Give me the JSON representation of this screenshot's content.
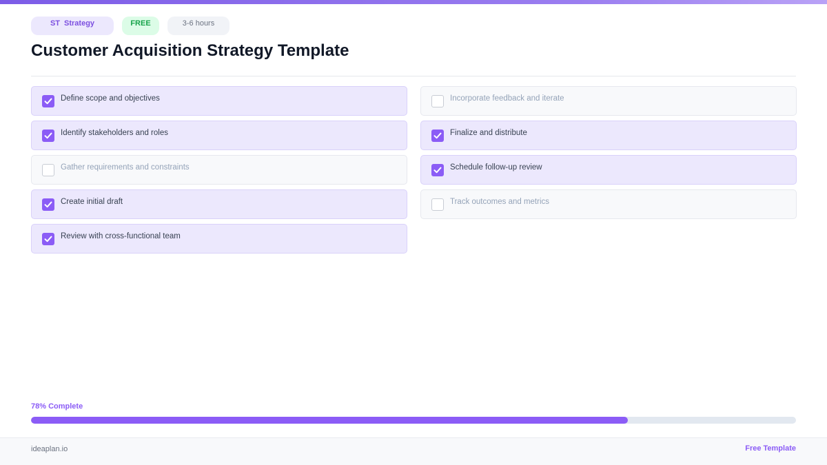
{
  "header": {
    "category_code": "ST",
    "category": "Strategy",
    "price": "FREE",
    "duration": "3-6 hours",
    "title": "Customer Acquisition Strategy Template"
  },
  "colors": {
    "accent": "#8b5cf6",
    "checked_bg": "#ece8fd",
    "unchecked_bg": "#f8f9fb",
    "free_badge": "#16a34a"
  },
  "checklist": {
    "left": [
      {
        "label": "Define scope and objectives",
        "checked": true
      },
      {
        "label": "Identify stakeholders and roles",
        "checked": true
      },
      {
        "label": "Gather requirements and constraints",
        "checked": false
      },
      {
        "label": "Create initial draft",
        "checked": true
      },
      {
        "label": "Review with cross-functional team",
        "checked": true
      }
    ],
    "right": [
      {
        "label": "Incorporate feedback and iterate",
        "checked": false
      },
      {
        "label": "Finalize and distribute",
        "checked": true
      },
      {
        "label": "Schedule follow-up review",
        "checked": true
      },
      {
        "label": "Track outcomes and metrics",
        "checked": false
      }
    ]
  },
  "progress": {
    "label": "78% Complete",
    "percent": 78
  },
  "footer": {
    "site": "ideaplan.io",
    "tag": "Free Template"
  }
}
